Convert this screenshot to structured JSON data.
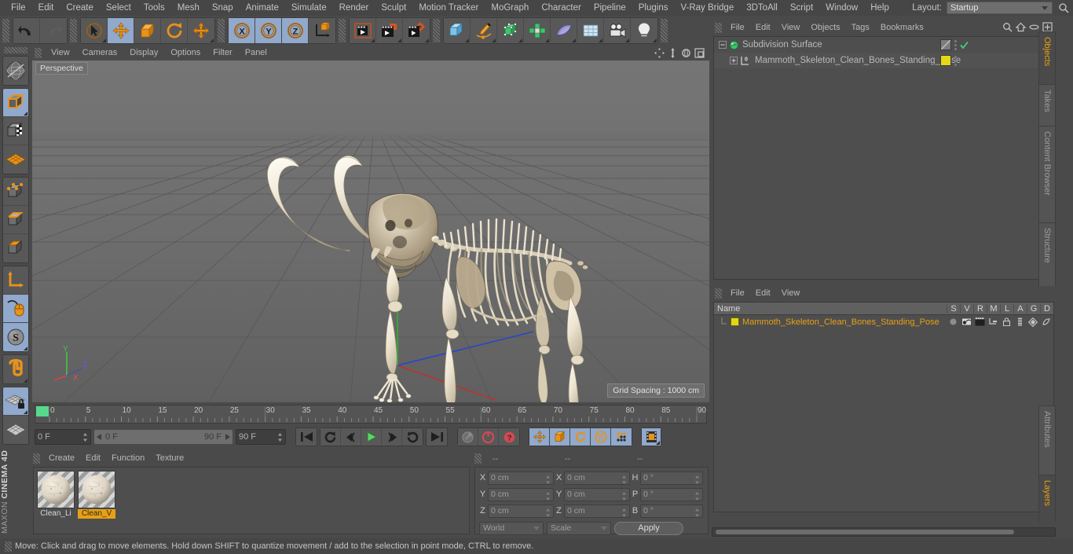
{
  "app": {
    "brand_top": "MAXON",
    "brand_bottom": "CINEMA 4D"
  },
  "menubar": {
    "items": [
      "File",
      "Edit",
      "Create",
      "Select",
      "Tools",
      "Mesh",
      "Snap",
      "Animate",
      "Simulate",
      "Render",
      "Sculpt",
      "Motion Tracker",
      "MoGraph",
      "Character",
      "Pipeline",
      "Plugins",
      "V-Ray Bridge",
      "3DToAll",
      "Script",
      "Window",
      "Help"
    ],
    "layout_label": "Layout:",
    "layout_value": "Startup",
    "search_icon": "search-icon"
  },
  "toolbar": {
    "groups": [
      {
        "name": "undo-redo",
        "buttons": [
          {
            "icon": "undo-icon",
            "label": "Undo",
            "selected": false
          },
          {
            "icon": "redo-icon",
            "label": "Redo",
            "selected": false
          }
        ]
      },
      {
        "name": "transform-tools",
        "buttons": [
          {
            "icon": "select-live-icon",
            "label": "Live Selection",
            "selected": false
          },
          {
            "icon": "move-icon",
            "label": "Move",
            "selected": true
          },
          {
            "icon": "scale-icon",
            "label": "Scale",
            "selected": false
          },
          {
            "icon": "rotate-icon",
            "label": "Rotate",
            "selected": false
          },
          {
            "icon": "move-axis-icon",
            "label": "Move Axis",
            "selected": false
          }
        ]
      },
      {
        "name": "axis-locks",
        "buttons": [
          {
            "icon": "x-axis-icon",
            "label": "X",
            "selected": true
          },
          {
            "icon": "y-axis-icon",
            "label": "Y",
            "selected": true
          },
          {
            "icon": "z-axis-icon",
            "label": "Z",
            "selected": true
          },
          {
            "icon": "world-coordinate-icon",
            "label": "World/Object",
            "selected": false
          }
        ]
      },
      {
        "name": "render-tools",
        "buttons": [
          {
            "icon": "render-view-icon",
            "label": "Render View",
            "selected": false
          },
          {
            "icon": "render-region-icon",
            "label": "Render to Picture Viewer",
            "selected": false
          },
          {
            "icon": "render-settings-icon",
            "label": "Edit Render Settings",
            "selected": false
          }
        ]
      },
      {
        "name": "create-objects",
        "buttons": [
          {
            "icon": "cube-icon",
            "label": "Add Cube Object",
            "selected": false
          },
          {
            "icon": "pen-spline-icon",
            "label": "Add Spline",
            "selected": false
          },
          {
            "icon": "nurbs-icon",
            "label": "Add Generator",
            "selected": false
          },
          {
            "icon": "array-icon",
            "label": "Add Modeling Object",
            "selected": false
          },
          {
            "icon": "deformer-icon",
            "label": "Add Deformer",
            "selected": false
          },
          {
            "icon": "scene-floor-icon",
            "label": "Add Scene Object",
            "selected": false
          },
          {
            "icon": "camera-icon",
            "label": "Add Camera",
            "selected": false
          },
          {
            "icon": "light-icon",
            "label": "Add Light",
            "selected": false
          }
        ]
      }
    ]
  },
  "left_toolbar": {
    "groups": [
      {
        "buttons": [
          {
            "icon": "texture-axis-icon",
            "label": "Texture Mode",
            "selected": false
          }
        ]
      },
      {
        "buttons": [
          {
            "icon": "model-mode-icon",
            "label": "Model Mode",
            "selected": true
          },
          {
            "icon": "object-axis-icon",
            "label": "Object Mode",
            "selected": false
          },
          {
            "icon": "polygon-grid-icon",
            "label": "Enable Axis Modification",
            "selected": false
          }
        ]
      },
      {
        "buttons": [
          {
            "icon": "points-mode-icon",
            "label": "Points",
            "selected": false
          },
          {
            "icon": "edges-mode-icon",
            "label": "Edges",
            "selected": false
          },
          {
            "icon": "polygons-mode-icon",
            "label": "Polygons",
            "selected": false
          }
        ]
      },
      {
        "buttons": [
          {
            "icon": "axis-l-icon",
            "label": "Enable Axis",
            "selected": false
          },
          {
            "icon": "mouse-viewport-icon",
            "label": "Viewport Solo",
            "selected": true
          },
          {
            "icon": "soft-selection-icon",
            "label": "Soft Selection",
            "selected": true
          }
        ]
      },
      {
        "buttons": [
          {
            "icon": "magnet-icon",
            "label": "Magnet",
            "selected": false
          }
        ]
      },
      {
        "buttons": [
          {
            "icon": "workplane-lock-icon",
            "label": "Workplane Lock",
            "selected": true
          },
          {
            "icon": "workplane-icon",
            "label": "Workplane",
            "selected": false
          }
        ]
      }
    ]
  },
  "viewport": {
    "menu": [
      "View",
      "Cameras",
      "Display",
      "Options",
      "Filter",
      "Panel"
    ],
    "icons": [
      "pan-icon",
      "dolly-icon",
      "rotate-view-icon",
      "maximize-view-icon"
    ],
    "view_label": "Perspective",
    "grid_spacing": "Grid Spacing : 1000 cm",
    "axis_gizmo": {
      "x": "X",
      "y": "Y",
      "z": "Z",
      "x_color": "#c83232",
      "y_color": "#32c832",
      "z_color": "#3232c8"
    },
    "scene_object": "Mammoth skeleton standing pose"
  },
  "timeline": {
    "ticks": [
      "0",
      "5",
      "10",
      "15",
      "20",
      "25",
      "30",
      "35",
      "40",
      "45",
      "50",
      "55",
      "60",
      "65",
      "70",
      "75",
      "80",
      "85",
      "90"
    ],
    "current_frame": "0 F",
    "range_start": "0 F",
    "range_end": "90 F",
    "end_frame": "90 F",
    "playhead_frame": "0 F",
    "transport": [
      {
        "icon": "go-to-start-icon",
        "label": "Go to Start"
      },
      {
        "icon": "previous-key-icon",
        "label": "Go to Previous Key"
      },
      {
        "icon": "step-back-icon",
        "label": "Go to Previous Frame"
      },
      {
        "icon": "play-icon",
        "label": "Play Forwards"
      },
      {
        "icon": "step-forward-icon",
        "label": "Go to Next Frame"
      },
      {
        "icon": "next-key-icon",
        "label": "Go to Next Key"
      },
      {
        "icon": "go-to-end-icon",
        "label": "Go to End"
      }
    ],
    "record_group": [
      {
        "icon": "autokey-icon",
        "label": "Autokeying",
        "selected": false
      },
      {
        "icon": "record-icon",
        "label": "Record Active Objects",
        "selected": false
      },
      {
        "icon": "keyframe-help-icon",
        "label": "Keyframe Selection",
        "selected": false
      }
    ],
    "param_group": [
      {
        "icon": "key-position-icon",
        "label": "Position",
        "selected": true
      },
      {
        "icon": "key-scale-icon",
        "label": "Scale",
        "selected": true
      },
      {
        "icon": "key-rotation-icon",
        "label": "Rotation",
        "selected": true
      },
      {
        "icon": "key-param-icon",
        "label": "Parameter",
        "selected": true
      },
      {
        "icon": "key-pla-icon",
        "label": "Point Level Animation",
        "selected": true
      }
    ],
    "timeline_toggle": {
      "icon": "timeline-icon",
      "label": "Timeline",
      "selected": true
    }
  },
  "material_manager": {
    "menu": [
      "Create",
      "Edit",
      "Function",
      "Texture"
    ],
    "materials": [
      {
        "name": "Clean_Li",
        "selected": false
      },
      {
        "name": "Clean_V",
        "selected": true
      }
    ]
  },
  "coordinates": {
    "headers": [
      "--",
      "--",
      "--"
    ],
    "position": [
      {
        "label": "X",
        "value": "0 cm"
      },
      {
        "label": "Y",
        "value": "0 cm"
      },
      {
        "label": "Z",
        "value": "0 cm"
      }
    ],
    "size": [
      {
        "label": "X",
        "value": "0 cm"
      },
      {
        "label": "Y",
        "value": "0 cm"
      },
      {
        "label": "Z",
        "value": "0 cm"
      }
    ],
    "rotation": [
      {
        "label": "H",
        "value": "0 °"
      },
      {
        "label": "P",
        "value": "0 °"
      },
      {
        "label": "B",
        "value": "0 °"
      }
    ],
    "coord_system": "World",
    "size_mode": "Scale",
    "apply_label": "Apply"
  },
  "object_manager": {
    "menu": [
      "File",
      "Edit",
      "View",
      "Objects",
      "Tags",
      "Bookmarks"
    ],
    "icons": [
      "search-icon",
      "home-icon",
      "ellipse-icon",
      "add-layer-icon"
    ],
    "rows": [
      {
        "name": "Subdivision Surface",
        "icon": "subdivision-surface-icon",
        "indent": 0,
        "expander": "minus",
        "tag_color": "#8a8a8a",
        "check": true
      },
      {
        "name": "Mammoth_Skeleton_Clean_Bones_Standing_Pose",
        "icon": "polygon-object-icon",
        "indent": 1,
        "expander": "plus",
        "tag_color": "#e5d617",
        "check": false
      }
    ]
  },
  "layer_manager": {
    "menu": [
      "File",
      "Edit",
      "View"
    ],
    "columns": [
      "Name",
      "S",
      "V",
      "R",
      "M",
      "L",
      "A",
      "G",
      "D"
    ],
    "rows": [
      {
        "name": "Mammoth_Skeleton_Clean_Bones_Standing_Pose",
        "color": "#e5d617"
      }
    ]
  },
  "right_tabs": {
    "top": [
      {
        "label": "Objects",
        "active": true
      },
      {
        "label": "Takes",
        "active": false
      },
      {
        "label": "Content Browser",
        "active": false
      },
      {
        "label": "Structure",
        "active": false
      }
    ],
    "bottom": [
      {
        "label": "Attributes",
        "active": false
      },
      {
        "label": "Layers",
        "active": true
      }
    ]
  },
  "status_bar": {
    "message": "Move: Click and drag to move elements. Hold down SHIFT to quantize movement / add to the selection in point mode, CTRL to remove."
  },
  "colors": {
    "accent_orange": "#e8a013",
    "selected_blue": "#90a9cc",
    "panel_bg": "#4a4a4a",
    "viewport_bg": "#6b6b6b"
  }
}
